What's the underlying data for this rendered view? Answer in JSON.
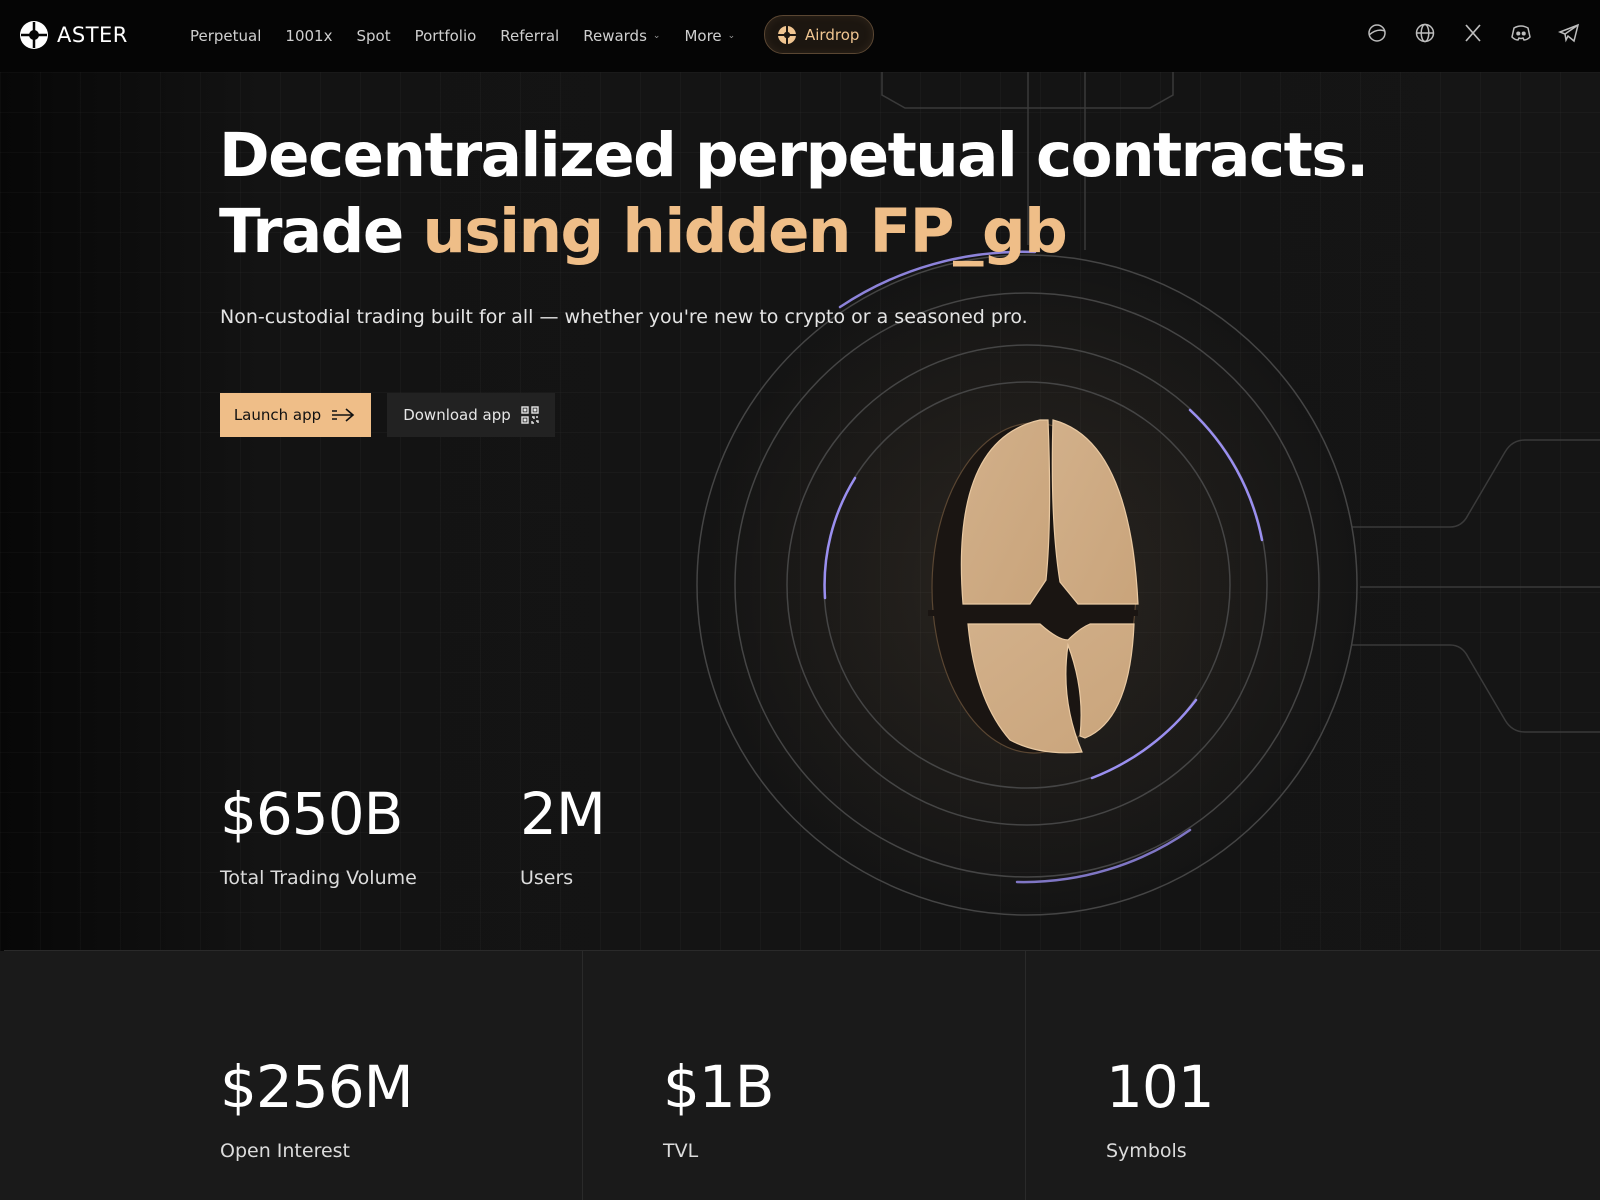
{
  "brand": {
    "name": "ASTER",
    "accent_color": "#efbe88",
    "ring_highlight_color": "#9a8ff0"
  },
  "nav": {
    "links": [
      {
        "label": "Perpetual"
      },
      {
        "label": "1001x"
      },
      {
        "label": "Spot"
      },
      {
        "label": "Portfolio"
      },
      {
        "label": "Referral"
      },
      {
        "label": "Rewards",
        "dropdown": true
      },
      {
        "label": "More",
        "dropdown": true
      }
    ],
    "airdrop_label": "Airdrop",
    "social_icons": [
      "planet-icon",
      "globe-icon",
      "x-icon",
      "discord-icon",
      "telegram-icon"
    ]
  },
  "hero": {
    "title_line1": "Decentralized perpetual contracts.",
    "title_line2_prefix": "Trade ",
    "title_line2_accent": "using hidden FP_gb",
    "subtitle": "Non-custodial trading built for all — whether you're new to crypto or a seasoned pro.",
    "launch_label": "Launch app",
    "download_label": "Download app"
  },
  "stats_top": [
    {
      "value": "$650B",
      "label": "Total Trading Volume"
    },
    {
      "value": "2M",
      "label": "Users"
    }
  ],
  "stats_bottom": [
    {
      "value": "$256M",
      "label": "Open Interest"
    },
    {
      "value": "$1B",
      "label": "TVL"
    },
    {
      "value": "101",
      "label": "Symbols"
    }
  ]
}
